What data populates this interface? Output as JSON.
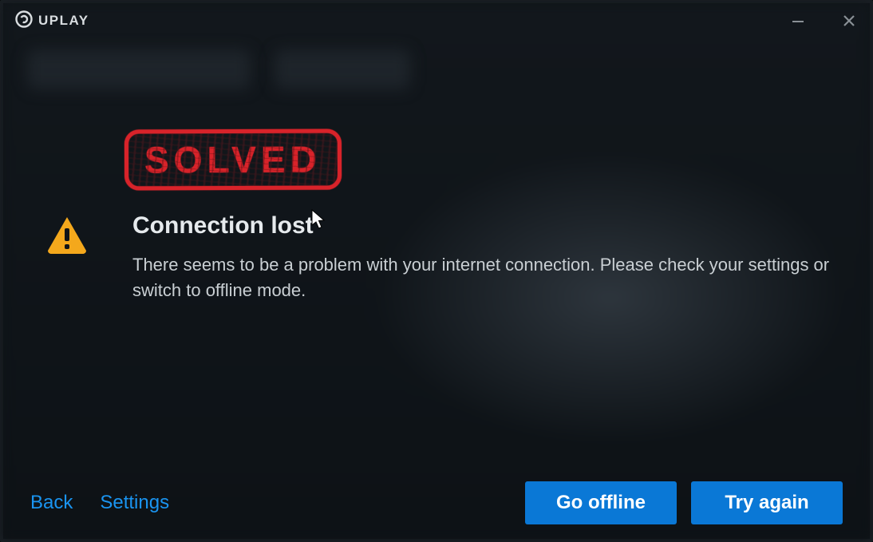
{
  "app": {
    "name": "UPLAY"
  },
  "overlay": {
    "stamp": "SOLVED"
  },
  "error": {
    "title": "Connection lost",
    "message": "There seems to be a problem with your internet connection. Please check your settings or switch to offline mode."
  },
  "footer": {
    "back": "Back",
    "settings": "Settings",
    "go_offline": "Go offline",
    "try_again": "Try again"
  },
  "colors": {
    "accent": "#0a78d6",
    "link": "#1a94f0",
    "warning": "#f4a81c",
    "stamp": "#d8232a"
  }
}
